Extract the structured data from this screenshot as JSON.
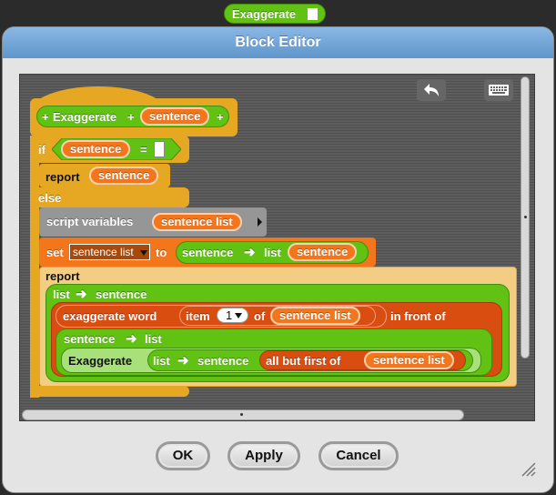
{
  "top_block": {
    "label": "Exaggerate"
  },
  "dialog": {
    "title": "Block Editor",
    "buttons": {
      "ok": "OK",
      "apply": "Apply",
      "cancel": "Cancel"
    }
  },
  "script": {
    "hat": {
      "plus_left": "+",
      "name": "Exaggerate",
      "plus_mid": "+",
      "param": "sentence",
      "plus_right": "+"
    },
    "if_block": {
      "keyword": "if",
      "var": "sentence",
      "op": "="
    },
    "report1": {
      "keyword": "report",
      "var": "sentence"
    },
    "else_label": "else",
    "script_vars": {
      "label": "script variables",
      "var": "sentence list"
    },
    "set_block": {
      "keyword": "set",
      "dropdown": "sentence list",
      "to": "to",
      "fn_left": "sentence",
      "fn_right": "list",
      "arg": "sentence"
    },
    "report2": {
      "keyword": "report",
      "outer": {
        "left": "list",
        "right": "sentence"
      },
      "in_front": {
        "word_block": "exaggerate word",
        "item": "item",
        "index": "1",
        "of": "of",
        "list_var": "sentence list",
        "label": "in front of"
      },
      "inner": {
        "left": "sentence",
        "right": "list"
      },
      "recursive": {
        "name": "Exaggerate",
        "left": "list",
        "right": "sentence",
        "all_but": "all but first of",
        "var": "sentence list"
      }
    }
  },
  "colors": {
    "control": "#e6a822",
    "operators": "#62c213",
    "variables": "#f3761d",
    "lists": "#d94d11",
    "other": "#969696",
    "title_bar": "#6fa4d8",
    "report_fill": "#f4cd84"
  }
}
